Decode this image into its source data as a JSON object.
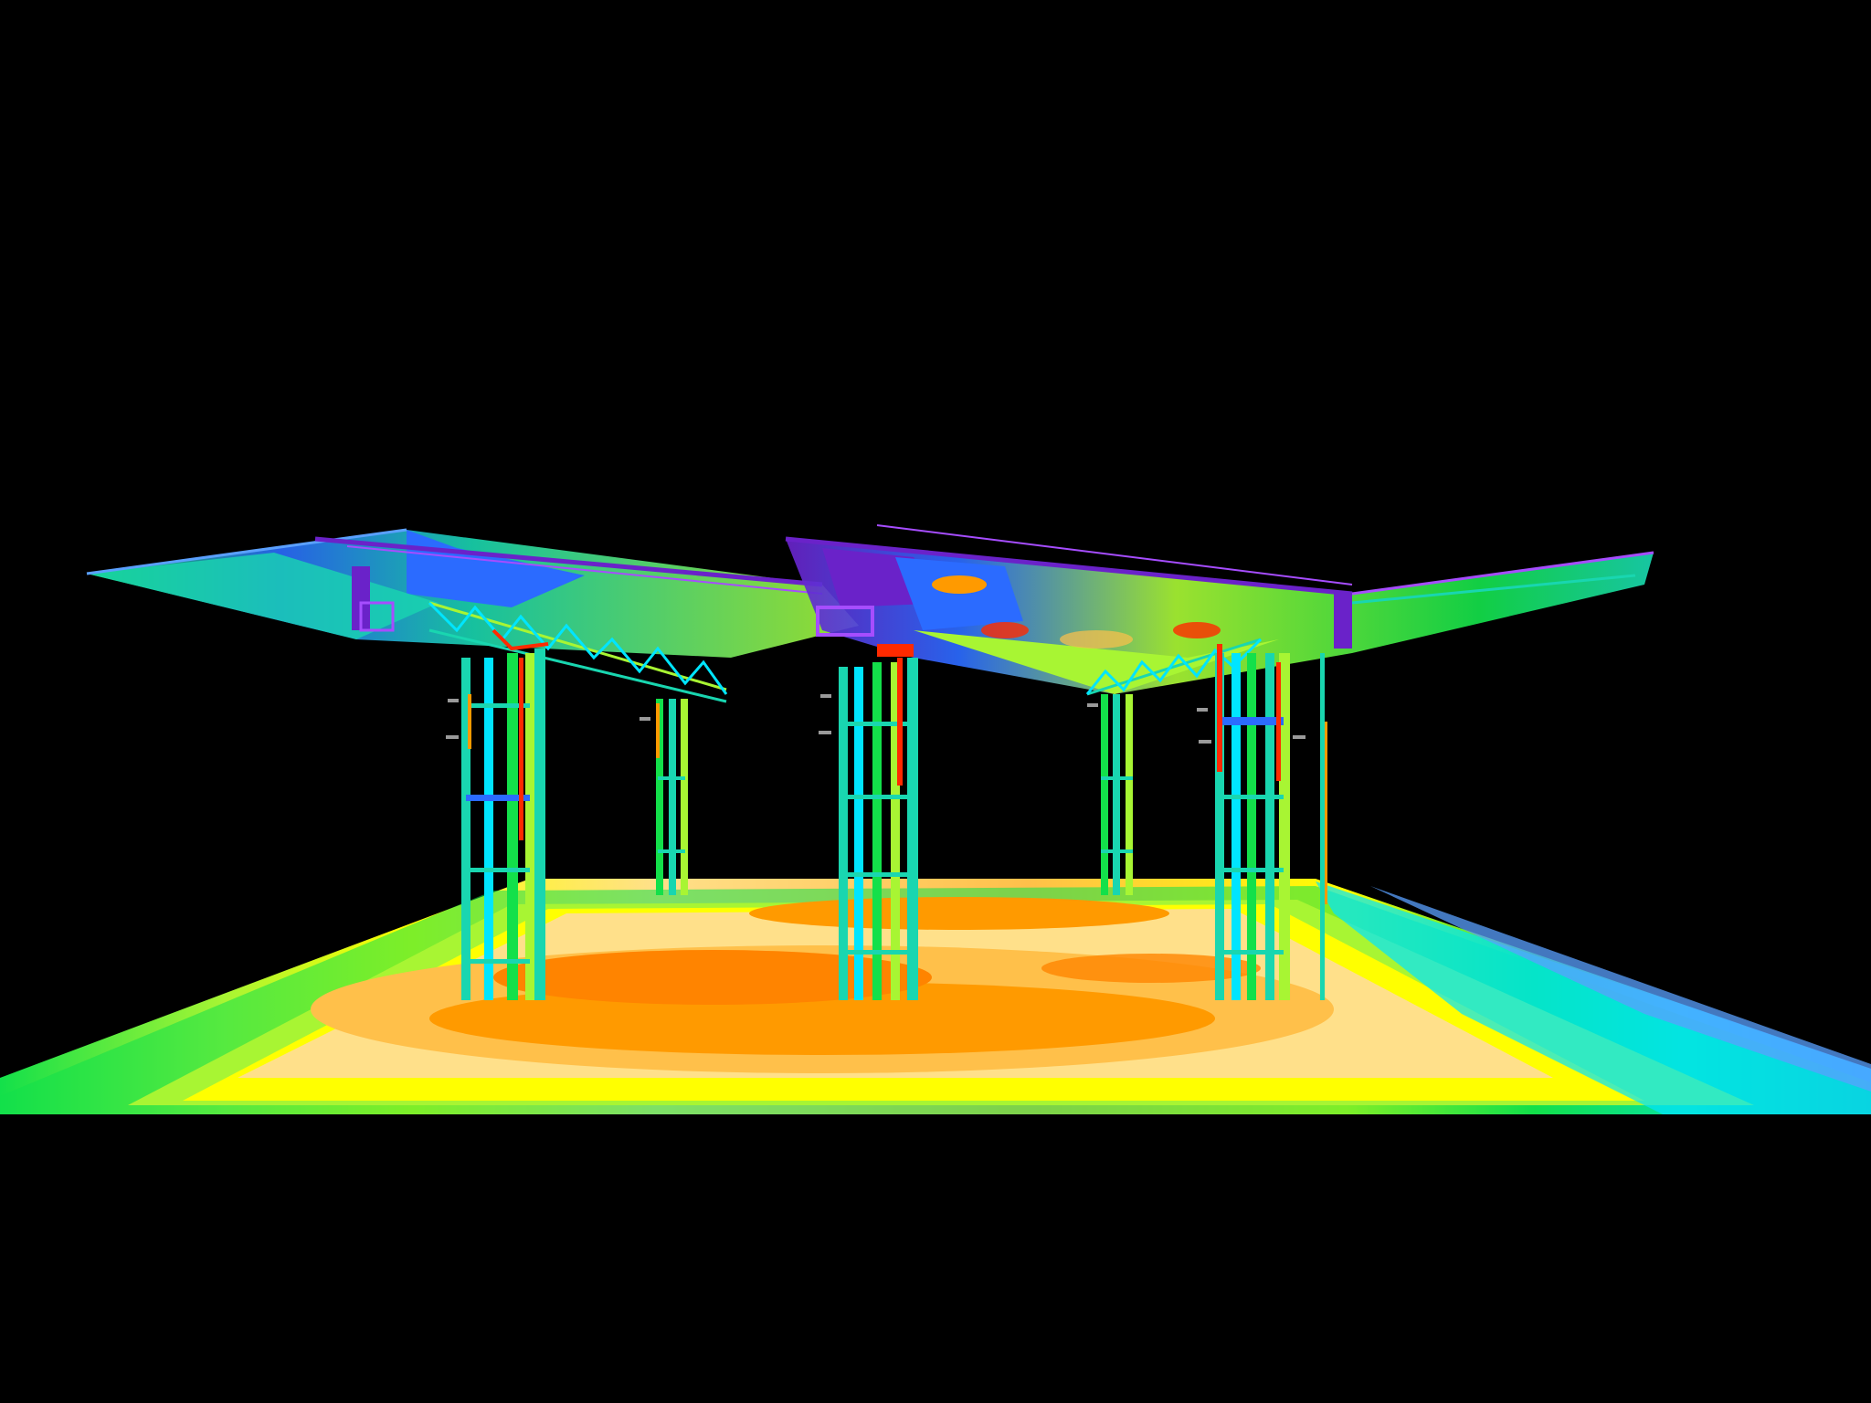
{
  "scene": {
    "kind": "structural-stress-contour-render",
    "background": "#000000",
    "palette": {
      "deep_blue": "#2b6bff",
      "light_blue": "#5aa0ff",
      "cyan": "#00e5ff",
      "aqua": "#19d6b0",
      "green": "#13e04a",
      "lime": "#a8f533",
      "yellow": "#ffff00",
      "pale_yellow": "#ffe08a",
      "light_orange": "#ffc04a",
      "orange": "#ff9a00",
      "dark_orange": "#ff8400",
      "red": "#ff2a00",
      "purple": "#6a22c9",
      "violet": "#a64dff"
    },
    "elements": {
      "ground_slab": "stress-contour-floor",
      "columns": [
        "column-front-left",
        "column-back-left",
        "column-front-center",
        "column-back-right",
        "column-front-right"
      ],
      "roof": [
        "roof-left-panel",
        "roof-right-panel"
      ],
      "trusses": [
        "truss-left",
        "truss-right"
      ]
    }
  }
}
